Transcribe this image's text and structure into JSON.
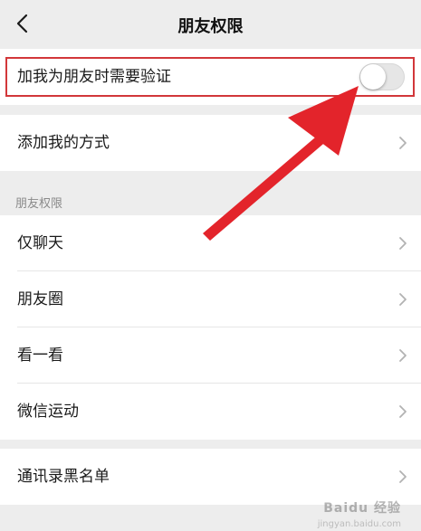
{
  "header": {
    "title": "朋友权限",
    "back_icon": "chevron-left-icon"
  },
  "verification": {
    "label": "加我为朋友时需要验证",
    "enabled": false
  },
  "add_methods": {
    "label": "添加我的方式"
  },
  "friend_permissions": {
    "section_title": "朋友权限",
    "items": [
      {
        "label": "仅聊天"
      },
      {
        "label": "朋友圈"
      },
      {
        "label": "看一看"
      },
      {
        "label": "微信运动"
      }
    ]
  },
  "blacklist": {
    "label": "通讯录黑名单"
  },
  "annotation": {
    "highlight_color": "#d2373a",
    "arrow_color": "#e3242b"
  },
  "watermark": {
    "text": "Baidu 经验",
    "sub": "jingyan.baidu.com"
  }
}
